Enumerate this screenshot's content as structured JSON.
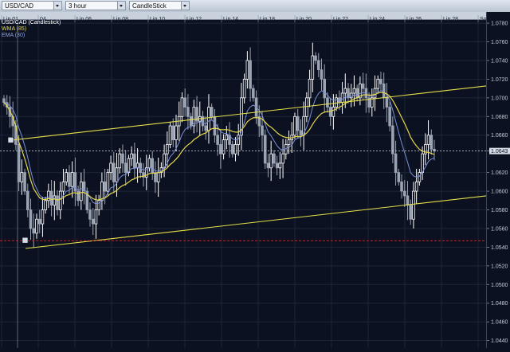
{
  "toolbar": {
    "symbol": "USD/CAD",
    "timeframe": "3 hour",
    "chart_type": "CandleStick"
  },
  "legend": {
    "title": "USD/CAD (Candlestick)",
    "wma": "WMA (85)",
    "ema": "EMA (30)"
  },
  "colors": {
    "background": "#0b1120",
    "bull": "#ffffff",
    "bear": "#9aa3b2",
    "wma": "#e6d84a",
    "ema": "#7a8fd8",
    "channel": "#e6e04a",
    "support": "#cc2222"
  },
  "date_labels": [
    "Lip 01",
    "04",
    "Lip 06",
    "Lip 08",
    "Lip 10",
    "Lip 12",
    "Lip 14",
    "Lip 18",
    "Lip 20",
    "Lip 22",
    "Lip 24",
    "Lip 26",
    "Lip 28",
    "Srp 02"
  ],
  "price_labels": [
    "1.0780",
    "1.0760",
    "1.0740",
    "1.0720",
    "1.0700",
    "1.0680",
    "1.0660",
    "1.0643",
    "1.0620",
    "1.0600",
    "1.0580",
    "1.0560",
    "1.0540",
    "1.0520",
    "1.0500",
    "1.0480",
    "1.0460",
    "1.0440"
  ],
  "current_price": "1.0643",
  "chart_data": {
    "type": "candlestick",
    "symbol": "USD/CAD",
    "timeframe": "3 hour",
    "ylim": [
      1.0432,
      1.0792
    ],
    "x_tick_labels": [
      "Lip 01",
      "04",
      "Lip 06",
      "Lip 08",
      "Lip 10",
      "Lip 12",
      "Lip 14",
      "Lip 18",
      "Lip 20",
      "Lip 22",
      "Lip 24",
      "Lip 26",
      "Lip 28",
      "Srp 02"
    ],
    "closes": [
      1.0695,
      1.069,
      1.068,
      1.067,
      1.065,
      1.061,
      1.062,
      1.06,
      1.058,
      1.056,
      1.0555,
      1.057,
      1.0565,
      1.058,
      1.059,
      1.06,
      1.0585,
      1.0595,
      1.058,
      1.06,
      1.061,
      1.062,
      1.0605,
      1.062,
      1.06,
      1.059,
      1.061,
      1.06,
      1.058,
      1.057,
      1.0565,
      1.058,
      1.059,
      1.061,
      1.06,
      1.062,
      1.063,
      1.061,
      1.0625,
      1.064,
      1.063,
      1.062,
      1.0635,
      1.064,
      1.0625,
      1.063,
      1.062,
      1.0615,
      1.0625,
      1.0635,
      1.062,
      1.061,
      1.062,
      1.0625,
      1.064,
      1.065,
      1.067,
      1.0655,
      1.067,
      1.068,
      1.07,
      1.069,
      1.068,
      1.067,
      1.069,
      1.0675,
      1.068,
      1.067,
      1.0665,
      1.069,
      1.068,
      1.066,
      1.065,
      1.064,
      1.0655,
      1.066,
      1.065,
      1.064,
      1.065,
      1.066,
      1.07,
      1.072,
      1.074,
      1.071,
      1.07,
      1.068,
      1.067,
      1.066,
      1.063,
      1.0625,
      1.064,
      1.063,
      1.0625,
      1.063,
      1.064,
      1.065,
      1.0655,
      1.066,
      1.068,
      1.0665,
      1.066,
      1.068,
      1.07,
      1.072,
      1.0745,
      1.074,
      1.073,
      1.072,
      1.07,
      1.069,
      1.068,
      1.069,
      1.07,
      1.0695,
      1.0705,
      1.071,
      1.07,
      1.0705,
      1.071,
      1.07,
      1.0715,
      1.071,
      1.07,
      1.069,
      1.07,
      1.071,
      1.072,
      1.0715,
      1.07,
      1.069,
      1.067,
      1.064,
      1.062,
      1.061,
      1.06,
      1.0595,
      1.0585,
      1.057,
      1.06,
      1.061,
      1.062,
      1.064,
      1.065,
      1.066,
      1.0645,
      1.0643
    ]
  }
}
